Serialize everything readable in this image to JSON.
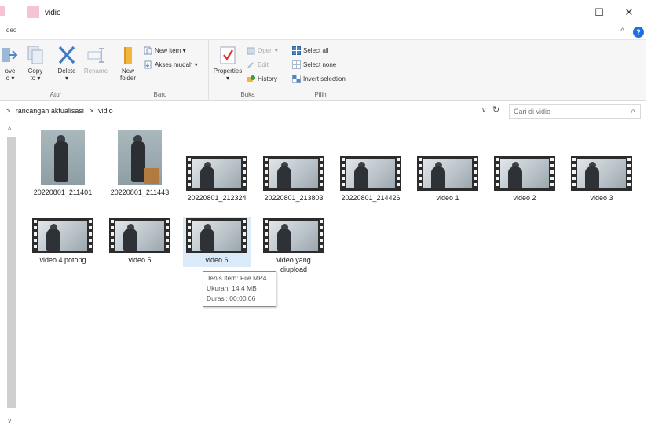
{
  "window": {
    "title": "vidio",
    "tab_hint": "deo",
    "controls": {
      "minimize": "—",
      "maximize": "☐",
      "close": "✕"
    }
  },
  "ribbon": {
    "collapse": "^",
    "help": "?",
    "groups": {
      "atur": {
        "label": "Atur",
        "move_label": "ove",
        "move_sub": "o ▾",
        "copy_label": "Copy",
        "copy_sub": "to ▾",
        "delete_label": "Delete",
        "delete_sub": "▾",
        "rename_label": "Rename"
      },
      "baru": {
        "label": "Baru",
        "new_folder_label": "New",
        "new_folder_sub": "folder",
        "new_item_label": "New item ▾",
        "easy_access_label": "Akses mudah ▾"
      },
      "buka": {
        "label": "Buka",
        "properties_label": "Properties",
        "properties_sub": "▾",
        "open_label": "Open ▾",
        "edit_label": "Edit",
        "history_label": "History"
      },
      "pilih": {
        "label": "Pilih",
        "select_all_label": "Select all",
        "select_none_label": "Select none",
        "invert_label": "Invert selection"
      }
    }
  },
  "address": {
    "crumbs": [
      ">",
      "rancangan aktualisasi",
      ">",
      "vidio"
    ],
    "dropdown": "∨",
    "refresh": "↻",
    "search_placeholder": "Cari di vidio"
  },
  "files": [
    {
      "caption": "20220801_211401",
      "kind": "photo"
    },
    {
      "caption": "20220801_211443",
      "kind": "photo"
    },
    {
      "caption": "20220801_212324",
      "kind": "video"
    },
    {
      "caption": "20220801_213803",
      "kind": "video"
    },
    {
      "caption": "20220801_214426",
      "kind": "video"
    },
    {
      "caption": "video 1",
      "kind": "video"
    },
    {
      "caption": "video 2",
      "kind": "video"
    },
    {
      "caption": "video 3",
      "kind": "video"
    },
    {
      "caption": "video 4 potong",
      "kind": "video"
    },
    {
      "caption": "video 5",
      "kind": "video"
    },
    {
      "caption": "video 6",
      "kind": "video",
      "selected": true
    },
    {
      "caption": "video yang diupload",
      "kind": "video"
    }
  ],
  "tooltip": {
    "type": "Jenis item: File MP4",
    "size": "Ukuran: 14,4 MB",
    "duration": "Durasi: 00:00:06"
  },
  "colors": {
    "accent": "#1f6ee8",
    "selection": "#dbeaf8",
    "folder": "#f2b53d"
  }
}
